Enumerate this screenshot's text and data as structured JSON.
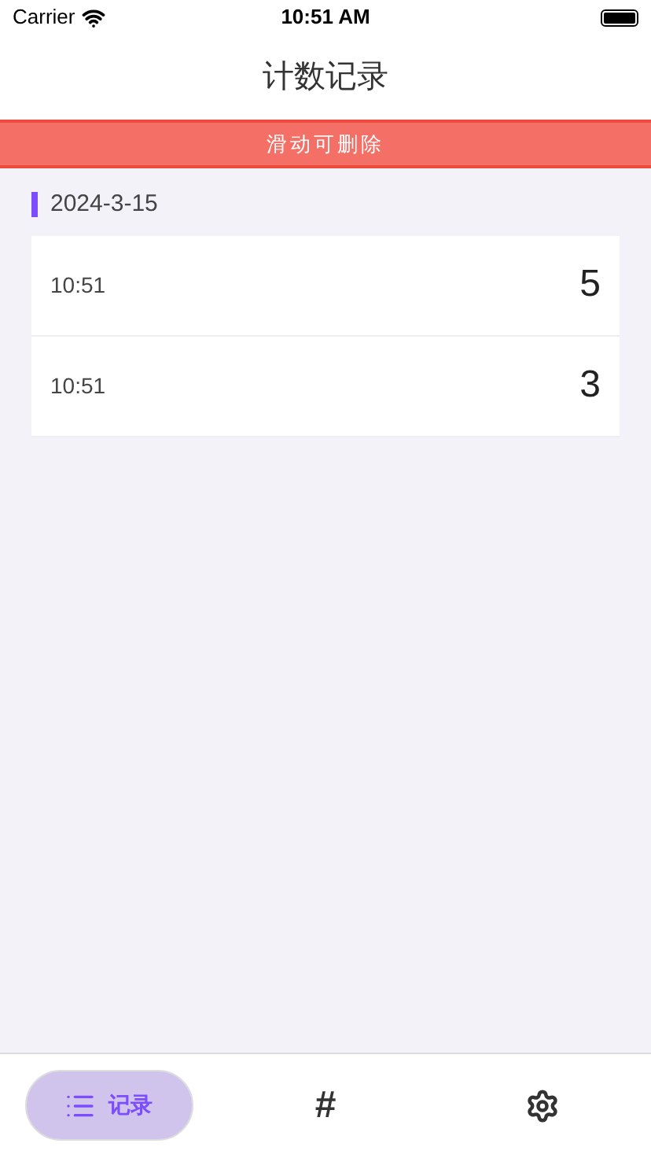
{
  "status_bar": {
    "carrier": "Carrier",
    "time": "10:51 AM"
  },
  "header": {
    "title": "计数记录"
  },
  "banner": {
    "text": "滑动可删除"
  },
  "groups": [
    {
      "date": "2024-3-15",
      "records": [
        {
          "time": "10:51",
          "count": "5"
        },
        {
          "time": "10:51",
          "count": "3"
        }
      ]
    }
  ],
  "tab_bar": [
    {
      "kind": "list",
      "label": "记录",
      "selected": true
    },
    {
      "kind": "hash",
      "glyph": "#",
      "selected": false
    },
    {
      "kind": "gear",
      "selected": false
    }
  ]
}
